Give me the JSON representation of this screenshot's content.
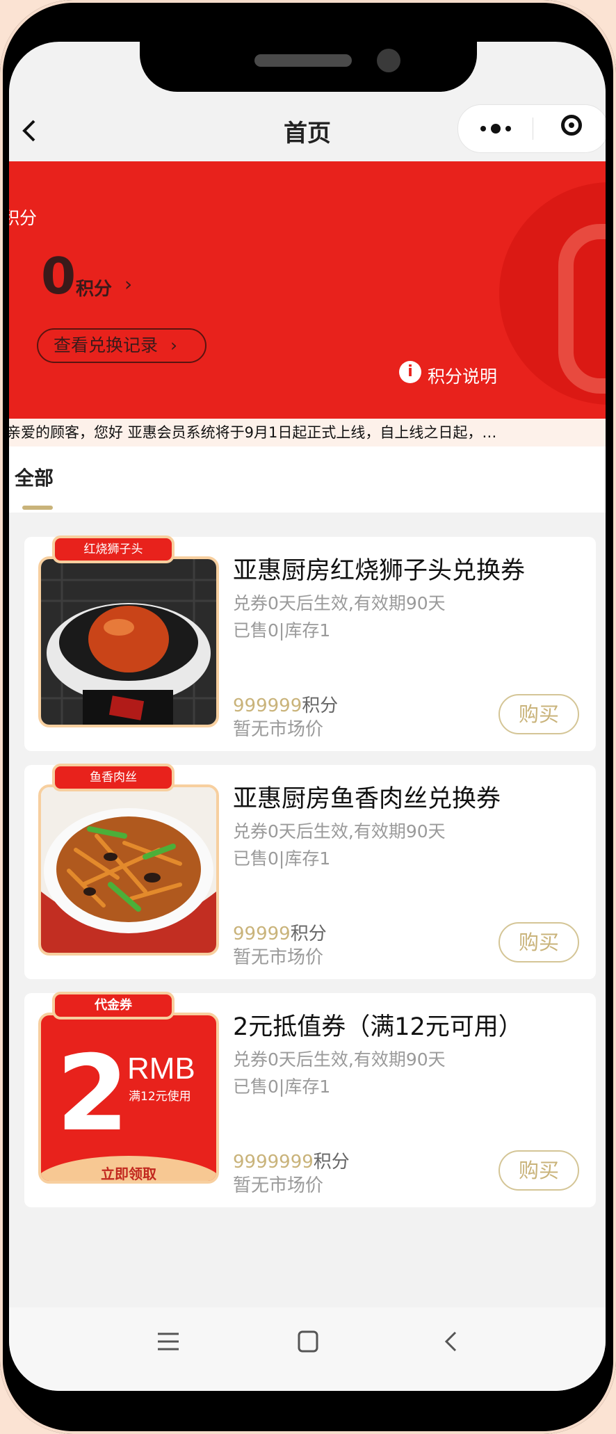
{
  "header": {
    "title": "首页",
    "back_icon": "chevron-left-icon",
    "more_icon": "more-dots-icon",
    "close_icon": "target-circle-icon"
  },
  "banner": {
    "partial_label": "积分",
    "points_value": "0",
    "points_unit": "积分",
    "records_button": "查看兑换记录",
    "info_label": "积分说明",
    "bg_color": "#e8221c"
  },
  "notice": {
    "text": "亲爱的顾客，您好 亚惠会员系统将于9月1日起正式上线，自上线之日起，…"
  },
  "tabs": {
    "all_label": "全部"
  },
  "products": [
    {
      "tag": "红烧狮子头",
      "title": "亚惠厨房红烧狮子头兑换券",
      "validity": "兑券0天后生效,有效期90天",
      "stock": "已售0|库存1",
      "price": "999999",
      "price_unit": "积分",
      "market": "暂无市场价",
      "buy": "购买"
    },
    {
      "tag": "鱼香肉丝",
      "title": "亚惠厨房鱼香肉丝兑换券",
      "validity": "兑券0天后生效,有效期90天",
      "stock": "已售0|库存1",
      "price": "99999",
      "price_unit": "积分",
      "market": "暂无市场价",
      "buy": "购买"
    },
    {
      "tag": "代金券",
      "title": "2元抵值券（满12元可用）",
      "validity": "兑券0天后生效,有效期90天",
      "stock": "已售0|库存1",
      "price": "9999999",
      "price_unit": "积分",
      "market": "暂无市场价",
      "buy": "购买",
      "voucher": {
        "amount": "2",
        "currency": "RMB",
        "condition": "满12元使用",
        "cta": "立即领取"
      }
    }
  ],
  "colors": {
    "accent": "#c9b37a",
    "red": "#e8221c"
  }
}
